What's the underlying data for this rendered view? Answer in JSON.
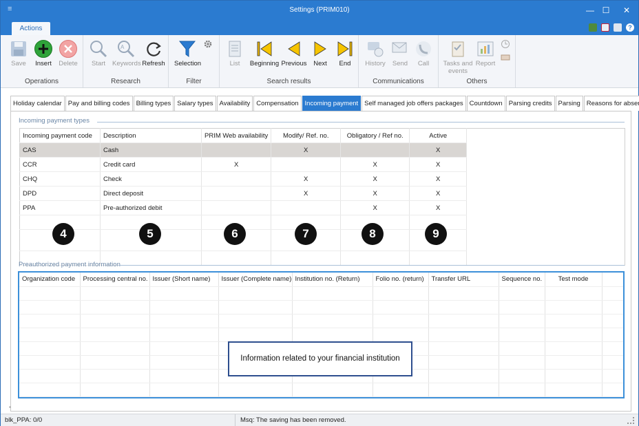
{
  "window": {
    "title": "Settings (PRIM010)",
    "controls": {
      "minimize": "—",
      "maximize": "☐",
      "close": "✕"
    }
  },
  "ribbon": {
    "tab_label": "Actions",
    "groups": [
      {
        "label": "Operations",
        "buttons": [
          {
            "label": "Save",
            "icon": "save-icon",
            "enabled": false
          },
          {
            "label": "Insert",
            "icon": "insert-icon",
            "enabled": true
          },
          {
            "label": "Delete",
            "icon": "delete-icon",
            "enabled": false
          }
        ]
      },
      {
        "label": "Research",
        "buttons": [
          {
            "label": "Start",
            "icon": "search-icon",
            "enabled": false
          },
          {
            "label": "Keywords",
            "icon": "keywords-icon",
            "enabled": false
          },
          {
            "label": "Refresh",
            "icon": "refresh-icon",
            "enabled": true
          }
        ]
      },
      {
        "label": "Filter",
        "buttons": [
          {
            "label": "Selection",
            "icon": "filter-icon",
            "enabled": true
          }
        ]
      },
      {
        "label": "Search results",
        "buttons": [
          {
            "label": "List",
            "icon": "list-icon",
            "enabled": false
          },
          {
            "label": "Beginning",
            "icon": "first-icon",
            "enabled": true
          },
          {
            "label": "Previous",
            "icon": "previous-icon",
            "enabled": true
          },
          {
            "label": "Next",
            "icon": "next-icon",
            "enabled": true
          },
          {
            "label": "End",
            "icon": "last-icon",
            "enabled": true
          }
        ]
      },
      {
        "label": "Communications",
        "buttons": [
          {
            "label": "History",
            "icon": "history-icon",
            "enabled": false
          },
          {
            "label": "Send",
            "icon": "send-icon",
            "enabled": false
          },
          {
            "label": "Call",
            "icon": "phone-icon",
            "enabled": false
          }
        ]
      },
      {
        "label": "Others",
        "buttons": [
          {
            "label": "Tasks and events",
            "icon": "tasks-icon",
            "enabled": false
          },
          {
            "label": "Report",
            "icon": "report-icon",
            "enabled": false
          }
        ]
      }
    ]
  },
  "tabs": [
    {
      "label": "Holiday calendar",
      "active": false
    },
    {
      "label": "Pay and billing codes",
      "active": false
    },
    {
      "label": "Billing types",
      "active": false
    },
    {
      "label": "Salary types",
      "active": false
    },
    {
      "label": "Availability",
      "active": false
    },
    {
      "label": "Compensation",
      "active": false
    },
    {
      "label": "Incoming payment",
      "active": true
    },
    {
      "label": "Self managed job offers packages",
      "active": false
    },
    {
      "label": "Countdown",
      "active": false
    },
    {
      "label": "Parsing credits",
      "active": false
    },
    {
      "label": "Parsing",
      "active": false
    },
    {
      "label": "Reasons for absence",
      "active": false
    }
  ],
  "incoming": {
    "section_title": "Incoming payment types",
    "columns": [
      "Incoming payment code",
      "Description",
      "PRIM Web availability",
      "Modify/ Ref. no.",
      "Obligatory /  Ref no.",
      "Active"
    ],
    "rows": [
      [
        "CAS",
        "Cash",
        "",
        "X",
        "",
        "X"
      ],
      [
        "CCR",
        "Credit card",
        "X",
        "",
        "X",
        "X"
      ],
      [
        "CHQ",
        "Check",
        "",
        "X",
        "X",
        "X"
      ],
      [
        "DPD",
        "Direct deposit",
        "",
        "X",
        "X",
        "X"
      ],
      [
        "PPA",
        "Pre-authorized debit",
        "",
        "",
        "X",
        "X"
      ]
    ],
    "selected_row": 0,
    "badges": [
      "4",
      "5",
      "6",
      "7",
      "8",
      "9"
    ]
  },
  "preauth": {
    "section_title": "Preauthorized payment information",
    "columns": [
      "Organization code",
      "Processing central no.",
      "Issuer (Short name)",
      "Issuer (Complete name)",
      "Institution no. (Return)",
      "Folio no. (return)",
      "Transfer URL",
      "Sequence no.",
      "Test mode"
    ],
    "callout": "Information related to your financial institution"
  },
  "status": {
    "left": "blk_PPA: 0/0",
    "message": "Msq: The saving has been removed."
  },
  "colors": {
    "accent": "#2b7bd0",
    "selected_row": "#d9d6d3",
    "grid_border": "#3b8fd9"
  }
}
